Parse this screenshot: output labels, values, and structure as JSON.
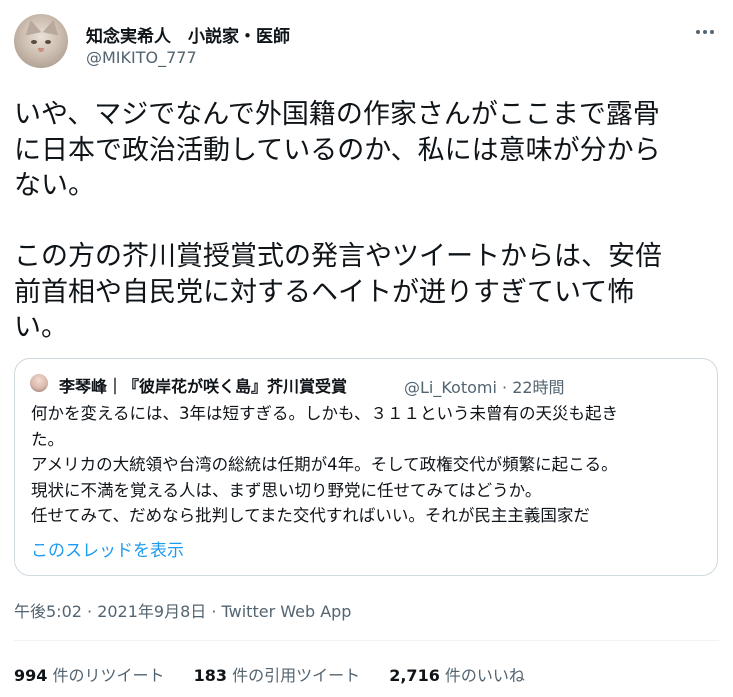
{
  "author": {
    "display_name": "知念実希人　小説家・医師",
    "handle": "@MIKITO_777"
  },
  "tweet": {
    "text": "いや、マジでなんで外国籍の作家さんがここまで露骨\nに日本で政治活動しているのか、私には意味が分から\nない。\n\nこの方の芥川賞授賞式の発言やツイートからは、安倍\n前首相や自民党に対するヘイトが迸りすぎていて怖\nい。",
    "meta": "午後5:02 · 2021年9月8日 · Twitter Web App"
  },
  "quote": {
    "name": "李琴峰｜『彼岸花が咲く島』芥川賞受賞",
    "meta": "@Li_Kotomi · 22時間",
    "text": "何かを変えるには、3年は短すぎる。しかも、３１１という未曾有の天災も起き\nた。\nアメリカの大統領や台湾の総統は任期が4年。そして政権交代が頻繁に起こる。\n現状に不満を覚える人は、まず思い切り野党に任せてみてはどうか。\n任せてみて、だめなら批判してまた交代すればいい。それが民主主義国家だ",
    "thread_link": "このスレッドを表示"
  },
  "stats": [
    {
      "number": "994",
      "label": "件のリツイート"
    },
    {
      "number": "183",
      "label": "件の引用ツイート"
    },
    {
      "number": "2,716",
      "label": "件のいいね"
    }
  ],
  "colors": {
    "text": "#0f1419",
    "secondary": "#536471",
    "link": "#1d9bf0",
    "border": "#cfd9de"
  },
  "icons": {
    "more": "more-horizontal-icon"
  }
}
